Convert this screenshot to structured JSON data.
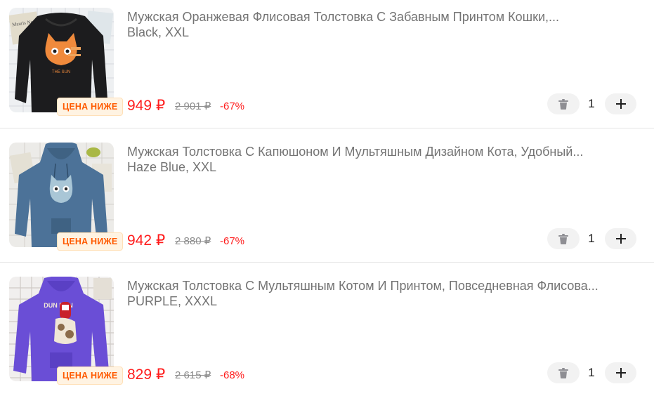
{
  "cart": {
    "items": [
      {
        "title": "Мужская Оранжевая Флисовая Толстовка С Забавным Принтом Кошки,...",
        "variant": "Black, XXL",
        "price": "949 ₽",
        "old_price": "2 901 ₽",
        "discount": "-67%",
        "badge": "ЦЕНА НИЖЕ",
        "quantity": "1",
        "print_text": "THE SUN",
        "image_tag": "Mauris News",
        "colors": {
          "hoodie": "#1c1c1e",
          "print": "#f08a3c"
        }
      },
      {
        "title": "Мужская Толстовка С Капюшоном И Мультяшным Дизайном Кота, Удобный...",
        "variant": "Haze Blue, XXL",
        "price": "942 ₽",
        "old_price": "2 880 ₽",
        "discount": "-67%",
        "badge": "ЦЕНА НИЖЕ",
        "quantity": "1",
        "colors": {
          "hoodie": "#4c7298",
          "print": "#a9c6d6"
        }
      },
      {
        "title": "Мужская Толстовка С Мультяшным Котом И Принтом, Повседневная Флисова...",
        "variant": "PURPLE, XXXL",
        "price": "829 ₽",
        "old_price": "2 615 ₽",
        "discount": "-68%",
        "badge": "ЦЕНА НИЖЕ",
        "quantity": "1",
        "print_text": "DUN DUN",
        "colors": {
          "hoodie": "#6a4ed6",
          "print": "#f0e6d6"
        }
      }
    ],
    "icons": {
      "delete": "trash-icon",
      "increase": "plus-icon"
    },
    "accent_colors": {
      "price": "#ff1d1d",
      "badge_text": "#ff5a00",
      "badge_bg": "#fff3e2"
    }
  }
}
